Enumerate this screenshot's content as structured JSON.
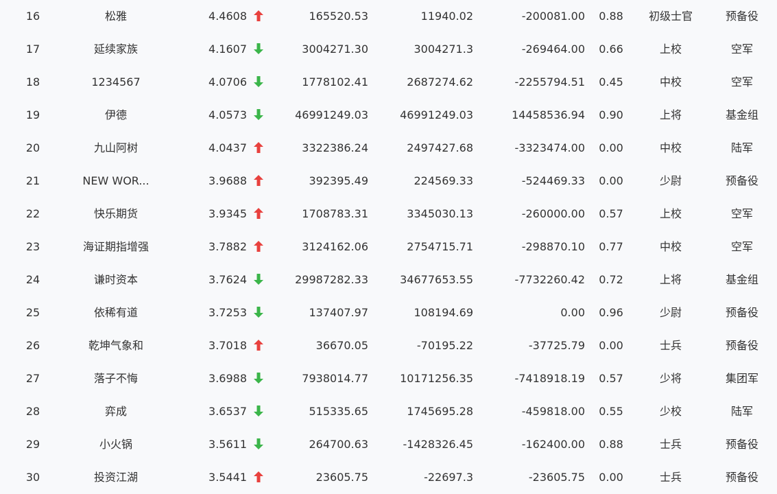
{
  "colors": {
    "up": "#e8413e",
    "down": "#3bb54a",
    "text": "#333333",
    "background": "#f8f9fb"
  },
  "icons": {
    "up": "arrow-up-icon",
    "down": "arrow-down-icon"
  },
  "rows": [
    {
      "rank": "16",
      "name": "松雅",
      "score": "4.4608",
      "trend": "up",
      "equity": "165520.53",
      "profit": "11940.02",
      "net": "-200081.00",
      "ratio": "0.88",
      "level": "初级士官",
      "group": "预备役"
    },
    {
      "rank": "17",
      "name": "延续家族",
      "score": "4.1607",
      "trend": "down",
      "equity": "3004271.30",
      "profit": "3004271.3",
      "net": "-269464.00",
      "ratio": "0.66",
      "level": "上校",
      "group": "空军"
    },
    {
      "rank": "18",
      "name": "1234567",
      "score": "4.0706",
      "trend": "down",
      "equity": "1778102.41",
      "profit": "2687274.62",
      "net": "-2255794.51",
      "ratio": "0.45",
      "level": "中校",
      "group": "空军"
    },
    {
      "rank": "19",
      "name": "伊德",
      "score": "4.0573",
      "trend": "down",
      "equity": "46991249.03",
      "profit": "46991249.03",
      "net": "14458536.94",
      "ratio": "0.90",
      "level": "上将",
      "group": "基金组"
    },
    {
      "rank": "20",
      "name": "九山阿树",
      "score": "4.0437",
      "trend": "up",
      "equity": "3322386.24",
      "profit": "2497427.68",
      "net": "-3323474.00",
      "ratio": "0.00",
      "level": "中校",
      "group": "陆军"
    },
    {
      "rank": "21",
      "name": "NEW WOR...",
      "score": "3.9688",
      "trend": "up",
      "equity": "392395.49",
      "profit": "224569.33",
      "net": "-524469.33",
      "ratio": "0.00",
      "level": "少尉",
      "group": "预备役"
    },
    {
      "rank": "22",
      "name": "快乐期货",
      "score": "3.9345",
      "trend": "up",
      "equity": "1708783.31",
      "profit": "3345030.13",
      "net": "-260000.00",
      "ratio": "0.57",
      "level": "上校",
      "group": "空军"
    },
    {
      "rank": "23",
      "name": "海证期指增强",
      "score": "3.7882",
      "trend": "up",
      "equity": "3124162.06",
      "profit": "2754715.71",
      "net": "-298870.10",
      "ratio": "0.77",
      "level": "中校",
      "group": "空军"
    },
    {
      "rank": "24",
      "name": "谦时资本",
      "score": "3.7624",
      "trend": "down",
      "equity": "29987282.33",
      "profit": "34677653.55",
      "net": "-7732260.42",
      "ratio": "0.72",
      "level": "上将",
      "group": "基金组"
    },
    {
      "rank": "25",
      "name": "依稀有道",
      "score": "3.7253",
      "trend": "down",
      "equity": "137407.97",
      "profit": "108194.69",
      "net": "0.00",
      "ratio": "0.96",
      "level": "少尉",
      "group": "预备役"
    },
    {
      "rank": "26",
      "name": "乾坤气象和",
      "score": "3.7018",
      "trend": "up",
      "equity": "36670.05",
      "profit": "-70195.22",
      "net": "-37725.79",
      "ratio": "0.00",
      "level": "士兵",
      "group": "预备役"
    },
    {
      "rank": "27",
      "name": "落子不悔",
      "score": "3.6988",
      "trend": "down",
      "equity": "7938014.77",
      "profit": "10171256.35",
      "net": "-7418918.19",
      "ratio": "0.57",
      "level": "少将",
      "group": "集团军"
    },
    {
      "rank": "28",
      "name": "弈成",
      "score": "3.6537",
      "trend": "down",
      "equity": "515335.65",
      "profit": "1745695.28",
      "net": "-459818.00",
      "ratio": "0.55",
      "level": "少校",
      "group": "陆军"
    },
    {
      "rank": "29",
      "name": "小火锅",
      "score": "3.5611",
      "trend": "down",
      "equity": "264700.63",
      "profit": "-1428326.45",
      "net": "-162400.00",
      "ratio": "0.88",
      "level": "士兵",
      "group": "预备役"
    },
    {
      "rank": "30",
      "name": "投资江湖",
      "score": "3.5441",
      "trend": "up",
      "equity": "23605.75",
      "profit": "-22697.3",
      "net": "-23605.75",
      "ratio": "0.00",
      "level": "士兵",
      "group": "预备役"
    }
  ]
}
